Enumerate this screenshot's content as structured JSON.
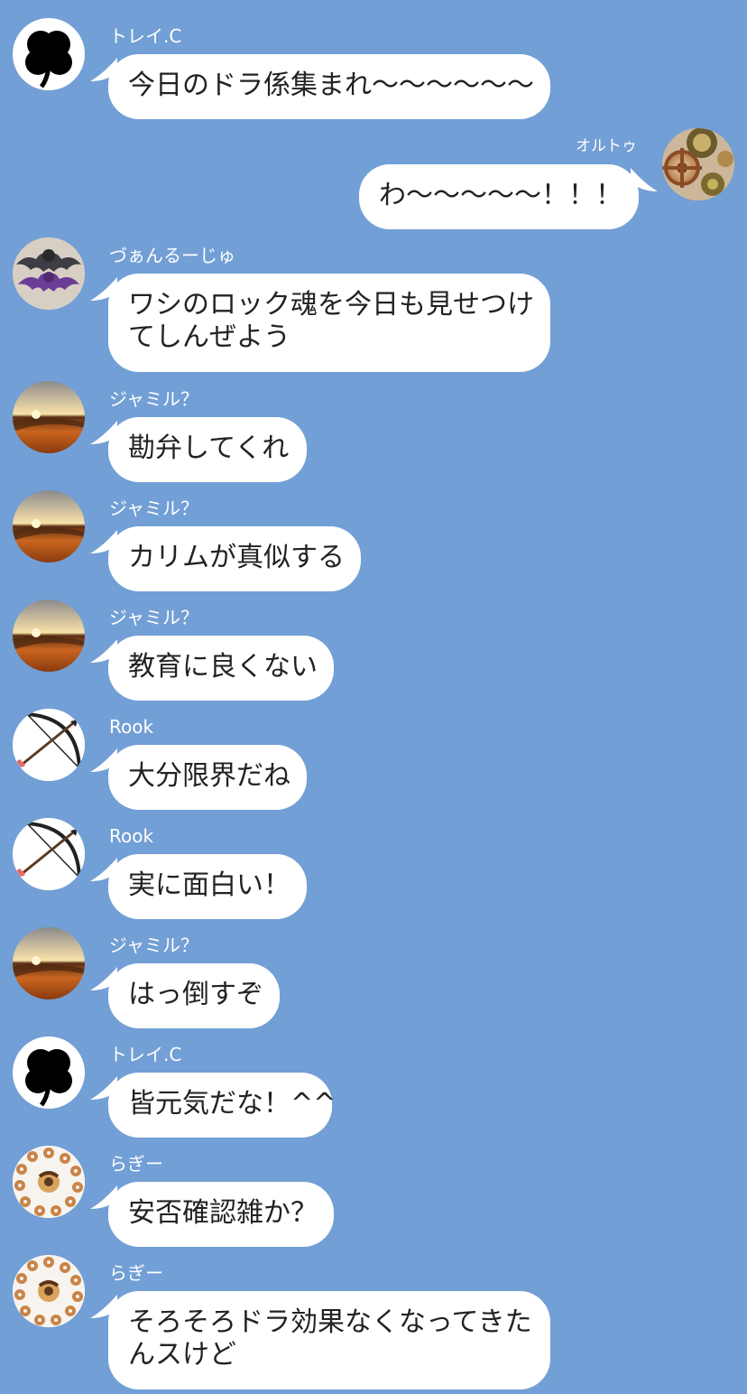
{
  "colors": {
    "background": "#729fd5",
    "bubble": "#ffffff",
    "text": "#222222",
    "sender": "#ffffff"
  },
  "messages": [
    {
      "id": "m1",
      "direction": "in",
      "sender": "トレイ.C",
      "avatar": "clover-icon",
      "lines": [
        "今日のドラ係集まれ〜〜〜〜〜〜"
      ]
    },
    {
      "id": "m2",
      "direction": "out",
      "sender": "オルトゥ",
      "avatar": "gears-icon",
      "lines": [
        "わ〜〜〜〜〜！！！"
      ]
    },
    {
      "id": "m3",
      "direction": "in",
      "sender": "づぁんるーじゅ",
      "avatar": "bat-icon",
      "lines": [
        "ワシのロック魂を今日も見せつけ",
        "てしんぜよう"
      ]
    },
    {
      "id": "m4",
      "direction": "in",
      "sender": "ジャミル？",
      "avatar": "desert-icon",
      "lines": [
        "勘弁してくれ"
      ]
    },
    {
      "id": "m5",
      "direction": "in",
      "sender": "ジャミル？",
      "avatar": "desert-icon",
      "lines": [
        "カリムが真似する"
      ]
    },
    {
      "id": "m6",
      "direction": "in",
      "sender": "ジャミル？",
      "avatar": "desert-icon",
      "lines": [
        "教育に良くない"
      ]
    },
    {
      "id": "m7",
      "direction": "in",
      "sender": "Rook",
      "avatar": "bow-arrow-icon",
      "lines": [
        "大分限界だね"
      ]
    },
    {
      "id": "m8",
      "direction": "in",
      "sender": "Rook",
      "avatar": "bow-arrow-icon",
      "lines": [
        "実に面白い！"
      ]
    },
    {
      "id": "m9",
      "direction": "in",
      "sender": "ジャミル？",
      "avatar": "desert-icon",
      "lines": [
        "はっ倒すぞ"
      ]
    },
    {
      "id": "m10",
      "direction": "in",
      "sender": "トレイ.C",
      "avatar": "clover-icon",
      "lines": [
        "皆元気だな！^^"
      ]
    },
    {
      "id": "m11",
      "direction": "in",
      "sender": "らぎー",
      "avatar": "donuts-icon",
      "lines": [
        "安否確認雑か？"
      ]
    },
    {
      "id": "m12",
      "direction": "in",
      "sender": "らぎー",
      "avatar": "donuts-icon",
      "lines": [
        "そろそろドラ効果なくなってきた",
        "んスけど"
      ]
    }
  ]
}
